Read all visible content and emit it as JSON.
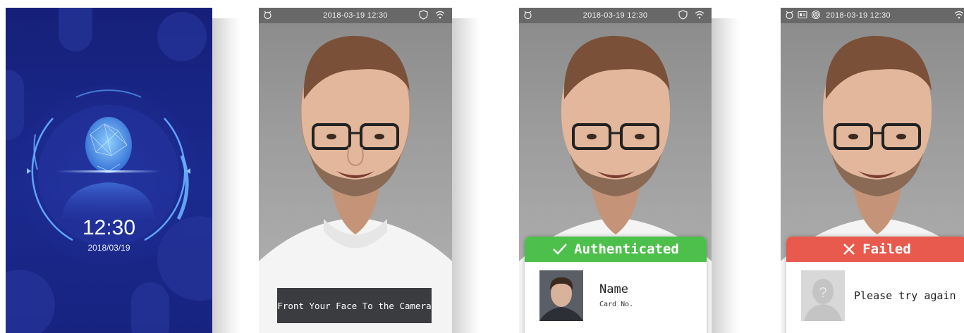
{
  "standby": {
    "time": "12:30",
    "date": "2018/03/19"
  },
  "statusbar": {
    "datetime": "2018-03-19 12:30"
  },
  "detecting": {
    "tip": "Front Your Face To the Camera"
  },
  "authenticated": {
    "title": "Authenticated",
    "name_label": "Name",
    "card_label": "Card No.",
    "header_color": "#4cc04a"
  },
  "failed": {
    "title": "Failed",
    "message": "Please try again",
    "header_color": "#e85a4d"
  },
  "icons": {
    "alarm": "alarm-icon",
    "shield": "shield-icon",
    "wifi": "wifi-icon",
    "card": "id-card-icon",
    "fingerprint": "fingerprint-icon"
  }
}
